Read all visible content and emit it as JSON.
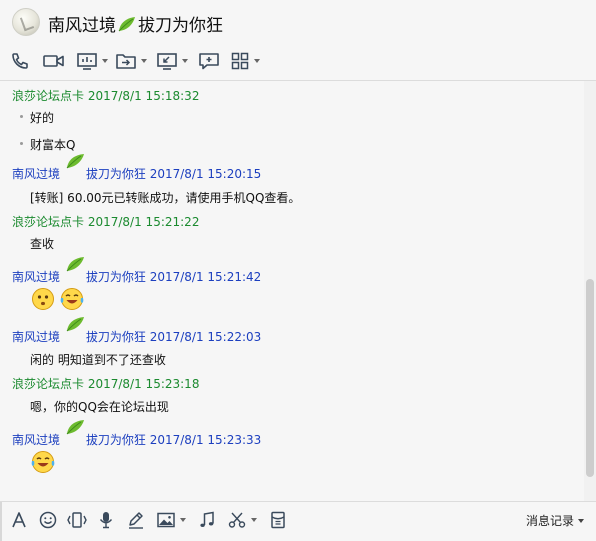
{
  "header": {
    "title_prefix": "南风过境",
    "title_suffix": "拔刀为你狂"
  },
  "toolbar": {
    "icons": [
      "phone-icon",
      "video-icon",
      "screen-share-icon",
      "file-transfer-icon",
      "remote-desktop-icon",
      "add-message-icon",
      "apps-grid-icon"
    ]
  },
  "messages": [
    {
      "sender": "浪莎论坛点卡",
      "time": "2017/8/1 15:18:32",
      "color": "#1b8a2f",
      "lines": [
        "好的",
        "财富本Q"
      ]
    },
    {
      "sender_prefix": "南风过境",
      "sender_suffix": "拔刀为你狂",
      "time": "2017/8/1 15:20:15",
      "color": "#1c3fbf",
      "lines": [
        "[转账] 60.00元已转账成功，请使用手机QQ查看。"
      ]
    },
    {
      "sender": "浪莎论坛点卡",
      "time": "2017/8/1 15:21:22",
      "color": "#1b8a2f",
      "lines": [
        "查收"
      ]
    },
    {
      "sender_prefix": "南风过境",
      "sender_suffix": "拔刀为你狂",
      "time": "2017/8/1 15:21:42",
      "color": "#1c3fbf",
      "emojis": [
        "dizzy-face-emoji",
        "tears-of-joy-emoji"
      ]
    },
    {
      "sender_prefix": "南风过境",
      "sender_suffix": "拔刀为你狂",
      "time": "2017/8/1 15:22:03",
      "color": "#1c3fbf",
      "lines": [
        "闲的  明知道到不了还查收"
      ]
    },
    {
      "sender": "浪莎论坛点卡",
      "time": "2017/8/1 15:23:18",
      "color": "#1b8a2f",
      "lines": [
        "嗯，你的QQ会在论坛出现"
      ]
    },
    {
      "sender_prefix": "南风过境",
      "sender_suffix": "拔刀为你狂",
      "time": "2017/8/1 15:23:33",
      "color": "#1c3fbf",
      "emojis": [
        "tears-of-joy-emoji"
      ]
    }
  ],
  "input_toolbar": {
    "icons": [
      "font-icon",
      "emoji-icon",
      "shake-icon",
      "voice-icon",
      "handwriting-icon",
      "image-icon",
      "music-icon",
      "screenshot-icon",
      "red-packet-icon"
    ],
    "history_label": "消息记录"
  },
  "scroll": {
    "position": 0.95
  }
}
